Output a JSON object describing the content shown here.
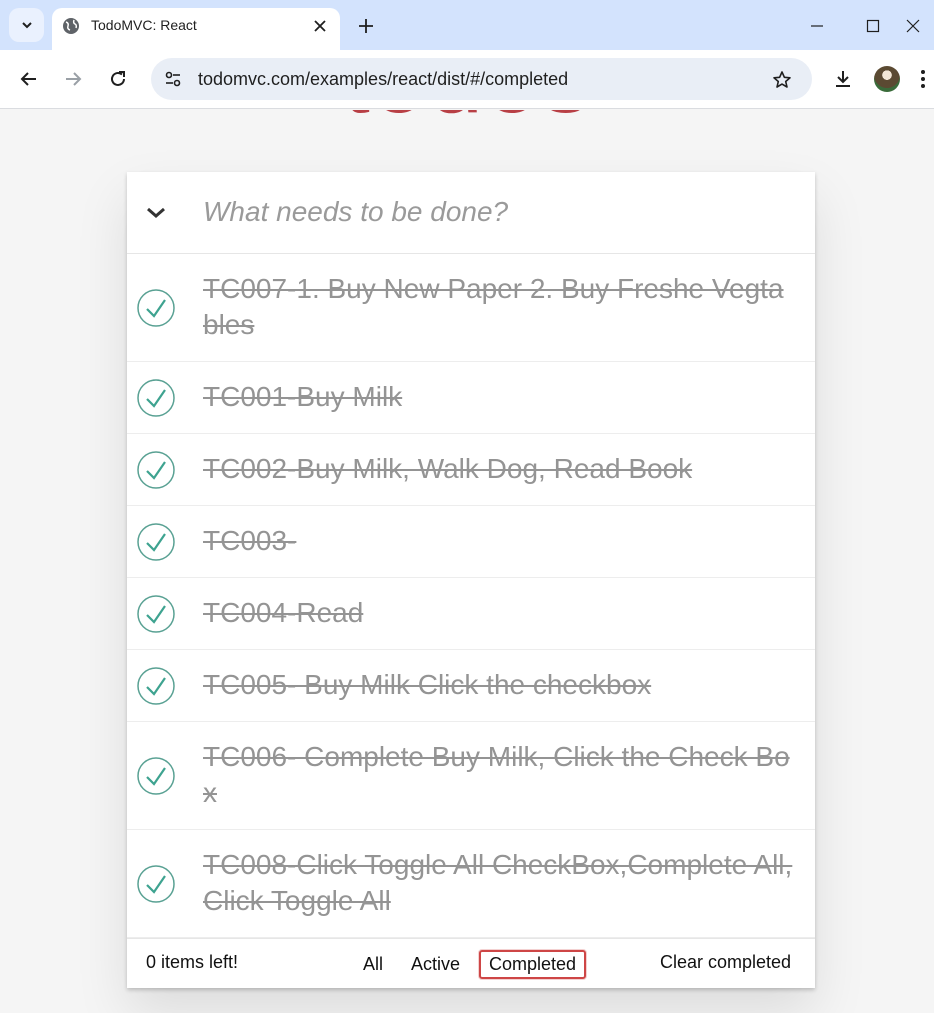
{
  "browser": {
    "tab_title": "TodoMVC: React",
    "url": "todomvc.com/examples/react/dist/#/completed",
    "colors": {
      "tabbar": "#d3e3fd",
      "omnibox": "#e9eef6"
    }
  },
  "app": {
    "heading": "todos",
    "input_placeholder": "What needs to be done?",
    "todos": [
      {
        "text": "TC007-1. Buy New Paper 2. Buy Freshe Vegtables",
        "completed": true
      },
      {
        "text": "TC001-Buy Milk",
        "completed": true
      },
      {
        "text": "TC002-Buy Milk, Walk Dog, Read Book",
        "completed": true
      },
      {
        "text": "TC003-",
        "completed": true
      },
      {
        "text": "TC004-Read",
        "completed": true
      },
      {
        "text": "TC005- Buy Milk Click the checkbox",
        "completed": true
      },
      {
        "text": "TC006- Complete Buy Milk, Click the Check Box",
        "completed": true
      },
      {
        "text": "TC008-Click Toggle All CheckBox,Complete All, Click Toggle All",
        "completed": true
      }
    ],
    "footer": {
      "count_text": "0 items left!",
      "filters": [
        "All",
        "Active",
        "Completed"
      ],
      "selected_filter": "Completed",
      "clear_label": "Clear completed"
    },
    "colors": {
      "heading": "#b83f45",
      "check": "#59a193",
      "selected_border": "#ce4646"
    }
  }
}
